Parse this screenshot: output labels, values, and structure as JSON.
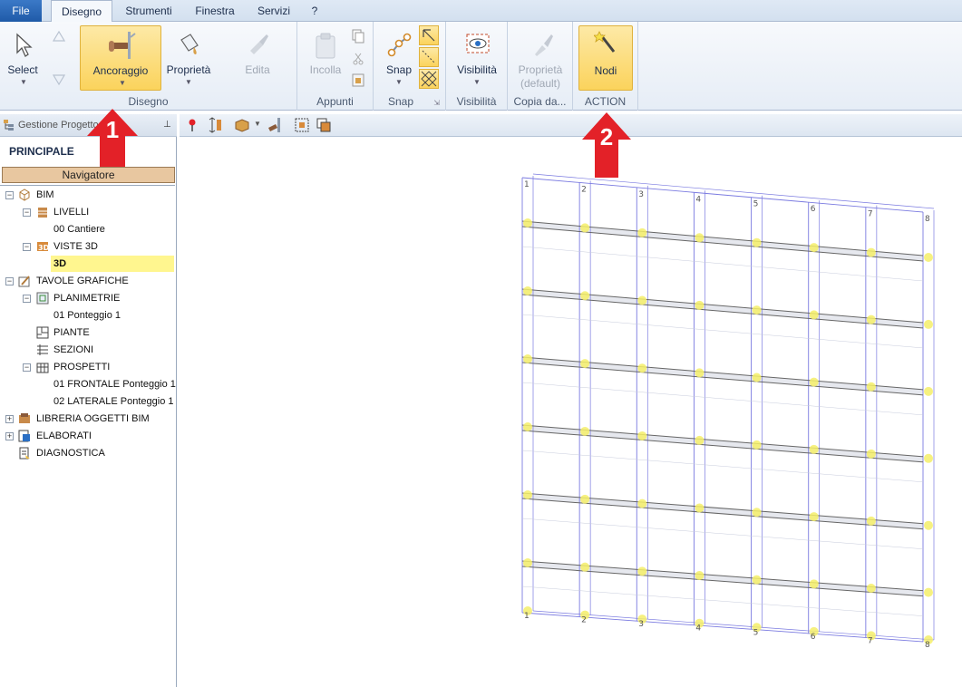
{
  "menu": {
    "tabs": [
      "File",
      "Disegno",
      "Strumenti",
      "Finestra",
      "Servizi",
      "?"
    ]
  },
  "ribbon": {
    "select_label": "Select",
    "ancoraggio_label": "Ancoraggio",
    "proprieta_label": "Proprietà",
    "edita_label": "Edita",
    "disegno_group": "Disegno",
    "incolla_label": "Incolla",
    "appunti_group": "Appunti",
    "snap_label": "Snap",
    "snap_group": "Snap",
    "visibilita_label": "Visibilità",
    "visibilita_group": "Visibilità",
    "proprieta_default_label": "Proprietà",
    "proprieta_default_sub": "(default)",
    "copia_group": "Copia da...",
    "nodi_label": "Nodi",
    "action_group": "ACTION"
  },
  "panel": {
    "title": "Gestione Progetto",
    "heading": "PRINCIPALE",
    "navigator": "Navigatore",
    "tree": {
      "bim": "BIM",
      "livelli": "LIVELLI",
      "cantiere": "00 Cantiere",
      "viste3d": "VISTE 3D",
      "v3d": "3D",
      "tavole": "TAVOLE GRAFICHE",
      "planimetrie": "PLANIMETRIE",
      "ponteggio": "01 Ponteggio 1",
      "piante": "PIANTE",
      "sezioni": "SEZIONI",
      "prospetti": "PROSPETTI",
      "frontale": "01 FRONTALE Ponteggio 1",
      "laterale": "02 LATERALE Ponteggio 1",
      "libreria": "LIBRERIA OGGETTI BIM",
      "elaborati": "ELABORATI",
      "diagnostica": "DIAGNOSTICA"
    }
  },
  "scaffold": {
    "column_labels": [
      "1",
      "2",
      "3",
      "4",
      "5",
      "6",
      "7",
      "8"
    ]
  },
  "annotations": {
    "arrow1": "1",
    "arrow2": "2"
  },
  "colors": {
    "accent_highlight": "#fbd35c",
    "arrow_red": "#e32128",
    "wire": "#7a7ae0",
    "node": "#f4ef6a"
  }
}
